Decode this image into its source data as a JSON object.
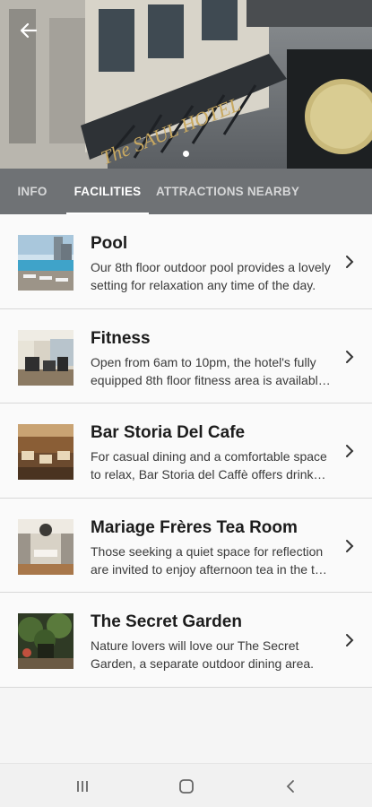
{
  "hero": {
    "sign_text": "The SAUL HOTEL",
    "carousel_count": 1,
    "carousel_active": 0
  },
  "tabs": [
    {
      "label": "INFO",
      "active": false
    },
    {
      "label": "FACILITIES",
      "active": true
    },
    {
      "label": "ATTRACTIONS NEARBY",
      "active": false
    }
  ],
  "facilities": [
    {
      "title": "Pool",
      "description": "Our 8th floor outdoor pool provides a lovely setting for relaxation any time of the day.",
      "thumb": "pool-photo"
    },
    {
      "title": "Fitness",
      "description": "Open from 6am to 10pm, the hotel's fully equipped 8th floor fitness area is available to guests.",
      "thumb": "gym-photo"
    },
    {
      "title": "Bar Storia Del Cafe",
      "description": "For casual dining and a comfortable space to relax, Bar Storia del Caffè offers drinks and light meals.",
      "thumb": "bar-photo"
    },
    {
      "title": "Mariage Frères Tea Room",
      "description": "Those seeking a quiet space for reflection are invited to enjoy afternoon tea in the tea room.",
      "thumb": "tea-room-photo"
    },
    {
      "title": "The Secret Garden",
      "description": "Nature lovers will love our The Secret Garden, a separate outdoor dining area.",
      "thumb": "garden-photo"
    }
  ],
  "icons": {
    "back": "arrow-left-icon",
    "chevron": "chevron-right-icon",
    "recents": "recents-icon",
    "home": "home-icon",
    "system_back": "system-back-icon"
  }
}
